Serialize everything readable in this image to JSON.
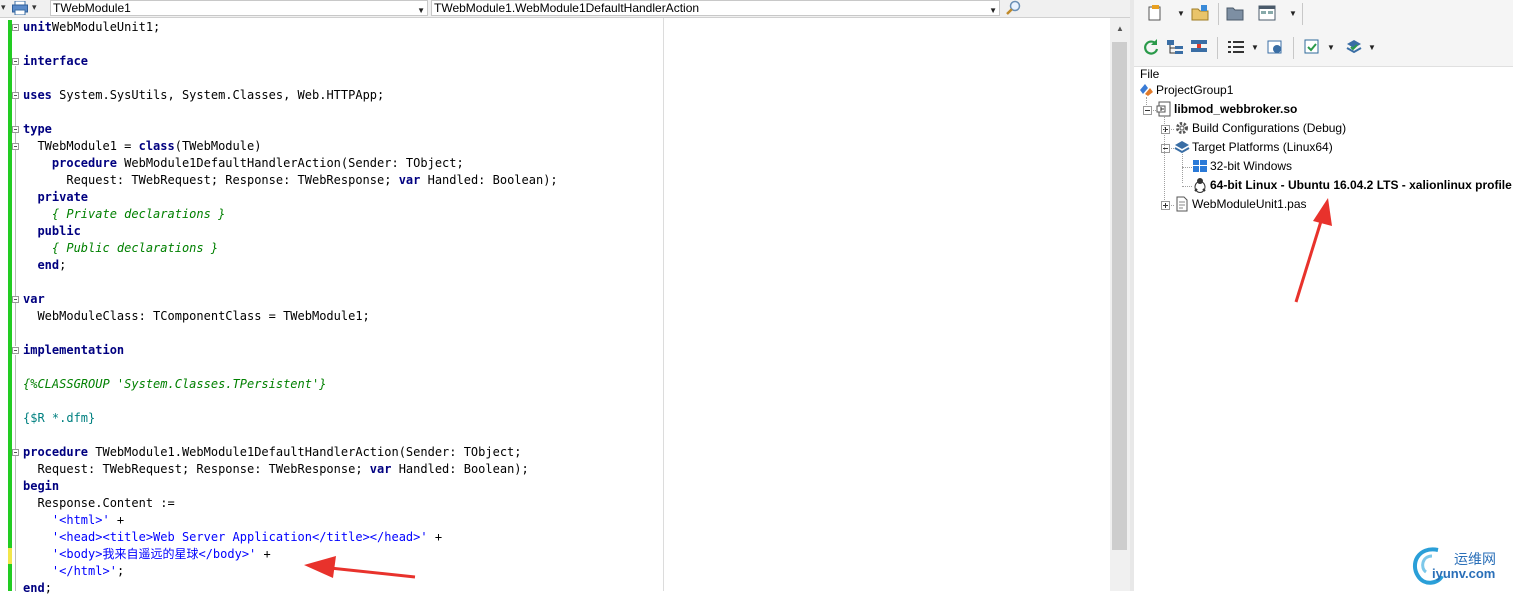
{
  "editor": {
    "class_combo": "TWebModule1",
    "method_combo": "TWebModule1.WebModule1DefaultHandlerAction",
    "lines": [
      {
        "tokens": [
          [
            "kw",
            "unit"
          ],
          [
            "",
            "WebModuleUnit1;"
          ]
        ],
        "row": 0,
        "indent": 0
      },
      {
        "tokens": [
          [
            "kw",
            "interface"
          ]
        ],
        "row": 2,
        "indent": 0
      },
      {
        "tokens": [
          [
            "kw",
            "uses"
          ],
          [
            "",
            " System.SysUtils, System.Classes, Web.HTTPApp;"
          ]
        ],
        "row": 4,
        "indent": 0
      },
      {
        "tokens": [
          [
            "kw",
            "type"
          ]
        ],
        "row": 6,
        "indent": 0
      },
      {
        "tokens": [
          [
            "",
            "  TWebModule1 = "
          ],
          [
            "kw",
            "class"
          ],
          [
            "",
            "(TWebModule)"
          ]
        ],
        "row": 7,
        "indent": 0
      },
      {
        "tokens": [
          [
            "",
            "    "
          ],
          [
            "kw",
            "procedure"
          ],
          [
            "",
            " WebModule1DefaultHandlerAction(Sender: TObject;"
          ]
        ],
        "row": 8,
        "indent": 0
      },
      {
        "tokens": [
          [
            "",
            "      Request: TWebRequest; Response: TWebResponse; "
          ],
          [
            "kw",
            "var"
          ],
          [
            "",
            " Handled: Boolean);"
          ]
        ],
        "row": 9,
        "indent": 0
      },
      {
        "tokens": [
          [
            "",
            "  "
          ],
          [
            "kw",
            "private"
          ]
        ],
        "row": 10,
        "indent": 0
      },
      {
        "tokens": [
          [
            "",
            "    "
          ],
          [
            "cm",
            "{ Private declarations }"
          ]
        ],
        "row": 11,
        "indent": 0
      },
      {
        "tokens": [
          [
            "",
            "  "
          ],
          [
            "kw",
            "public"
          ]
        ],
        "row": 12,
        "indent": 0
      },
      {
        "tokens": [
          [
            "",
            "    "
          ],
          [
            "cm",
            "{ Public declarations }"
          ]
        ],
        "row": 13,
        "indent": 0
      },
      {
        "tokens": [
          [
            "",
            "  "
          ],
          [
            "kw",
            "end"
          ],
          [
            "",
            ";"
          ]
        ],
        "row": 14,
        "indent": 0
      },
      {
        "tokens": [
          [
            "kw",
            "var"
          ]
        ],
        "row": 16,
        "indent": 0
      },
      {
        "tokens": [
          [
            "",
            "  WebModuleClass: TComponentClass = TWebModule1;"
          ]
        ],
        "row": 17,
        "indent": 0
      },
      {
        "tokens": [
          [
            "kw",
            "implementation"
          ]
        ],
        "row": 19,
        "indent": 0
      },
      {
        "tokens": [
          [
            "cm",
            "{%CLASSGROUP 'System.Classes.TPersistent'}"
          ]
        ],
        "row": 21,
        "indent": 0
      },
      {
        "tokens": [
          [
            "dir",
            "{$R *.dfm}"
          ]
        ],
        "row": 23,
        "indent": 0
      },
      {
        "tokens": [
          [
            "kw",
            "procedure"
          ],
          [
            "",
            " TWebModule1.WebModule1DefaultHandlerAction(Sender: TObject;"
          ]
        ],
        "row": 25,
        "indent": 0
      },
      {
        "tokens": [
          [
            "",
            "  Request: TWebRequest; Response: TWebResponse; "
          ],
          [
            "kw",
            "var"
          ],
          [
            "",
            " Handled: Boolean);"
          ]
        ],
        "row": 26,
        "indent": 0
      },
      {
        "tokens": [
          [
            "kw",
            "begin"
          ]
        ],
        "row": 27,
        "indent": 0
      },
      {
        "tokens": [
          [
            "",
            "  Response.Content :="
          ]
        ],
        "row": 28,
        "indent": 0
      },
      {
        "tokens": [
          [
            "",
            "    "
          ],
          [
            "str",
            "'<html>'"
          ],
          [
            "",
            " +"
          ]
        ],
        "row": 29,
        "indent": 0
      },
      {
        "tokens": [
          [
            "",
            "    "
          ],
          [
            "str",
            "'<head><title>Web Server Application</title></head>'"
          ],
          [
            "",
            " +"
          ]
        ],
        "row": 30,
        "indent": 0
      },
      {
        "tokens": [
          [
            "",
            "    "
          ],
          [
            "str",
            "'<body>我来自遥远的星球</body>'"
          ],
          [
            "",
            " +"
          ]
        ],
        "row": 31,
        "indent": 0
      },
      {
        "tokens": [
          [
            "",
            "    "
          ],
          [
            "str",
            "'</html>'"
          ],
          [
            "",
            ";"
          ]
        ],
        "row": 32,
        "indent": 0
      },
      {
        "tokens": [
          [
            "kw",
            "end"
          ],
          [
            "",
            ";"
          ]
        ],
        "row": 33,
        "indent": 0
      }
    ]
  },
  "project": {
    "file_label": "File",
    "nodes": [
      {
        "label": "ProjectGroup1",
        "level": 0,
        "icon": "project-group-icon",
        "bold": false,
        "expander": "none"
      },
      {
        "label": "libmod_webbroker.so",
        "level": 1,
        "icon": "project-file-icon",
        "bold": true,
        "expander": "minus"
      },
      {
        "label": "Build Configurations (Debug)",
        "level": 2,
        "icon": "gear-config-icon",
        "bold": false,
        "expander": "plus"
      },
      {
        "label": "Target Platforms (Linux64)",
        "level": 2,
        "icon": "platforms-stack-icon",
        "bold": false,
        "expander": "minus"
      },
      {
        "label": "32-bit Windows",
        "level": 3,
        "icon": "windows-logo-icon",
        "bold": false,
        "expander": "none"
      },
      {
        "label": "64-bit Linux - Ubuntu 16.04.2 LTS - xalionlinux profile",
        "level": 3,
        "icon": "linux-penguin-icon",
        "bold": true,
        "expander": "none"
      },
      {
        "label": "WebModuleUnit1.pas",
        "level": 2,
        "icon": "pascal-unit-icon",
        "bold": false,
        "expander": "plus"
      }
    ]
  },
  "watermark": {
    "cn": "运维网",
    "en": "iyunv.com"
  },
  "colors": {
    "keyword": "#000080",
    "comment": "#008000",
    "string": "#0000ff",
    "directive": "#008080",
    "gutter_green": "#22cc22",
    "gutter_yellow": "#f2e64a",
    "annotation_arrow": "#e8322c"
  }
}
